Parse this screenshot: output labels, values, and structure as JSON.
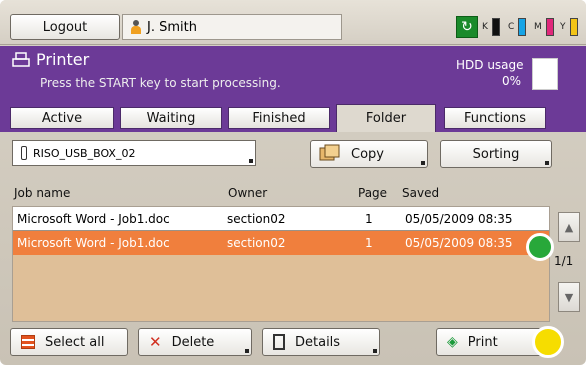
{
  "topbar": {
    "logout_label": "Logout",
    "user_name": "J. Smith",
    "ink": [
      {
        "letter": "K",
        "color": "#111111"
      },
      {
        "letter": "C",
        "color": "#17a4e6"
      },
      {
        "letter": "M",
        "color": "#e0287a"
      },
      {
        "letter": "Y",
        "color": "#f2c417"
      }
    ]
  },
  "header": {
    "title": "Printer",
    "message": "Press the START key to start processing.",
    "hdd_label": "HDD usage",
    "hdd_value": "0%"
  },
  "tabs": [
    {
      "label": "Active",
      "active": false
    },
    {
      "label": "Waiting",
      "active": false
    },
    {
      "label": "Finished",
      "active": false
    },
    {
      "label": "Folder",
      "active": true
    },
    {
      "label": "Functions",
      "active": false
    }
  ],
  "toolbar": {
    "box_name": "RISO_USB_BOX_02",
    "copy_label": "Copy",
    "sorting_label": "Sorting"
  },
  "table": {
    "headers": [
      "Job name",
      "Owner",
      "Page",
      "Saved"
    ],
    "rows": [
      {
        "job": "Microsoft Word - Job1.doc",
        "owner": "section02",
        "page": "1",
        "saved": "05/05/2009 08:35",
        "selected": false
      },
      {
        "job": "Microsoft Word - Job1.doc",
        "owner": "section02",
        "page": "1",
        "saved": "05/05/2009 08:35",
        "selected": true
      }
    ],
    "page_info": "1/1"
  },
  "bottom": {
    "select_all_label": "Select all",
    "delete_label": "Delete",
    "details_label": "Details",
    "print_label": "Print"
  },
  "colors": {
    "header_purple": "#6c3a97",
    "selected_row": "#f07f3d",
    "marker_green": "#28a83a",
    "marker_yellow": "#f6dd00"
  }
}
